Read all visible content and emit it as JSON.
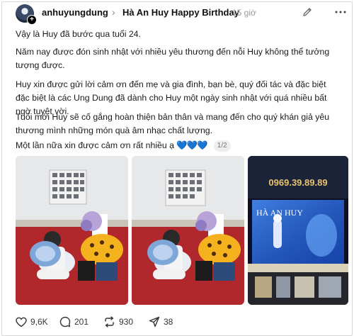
{
  "post": {
    "username": "anhuyungdung",
    "topic": "Hà An Huy Happy Birthday",
    "time_ago": "15 giờ",
    "paragraphs": [
      "Vậy là Huy đã bước qua tuổi 24.",
      "Năm nay được đón sinh nhật với nhiều yêu thương đến nỗi Huy không thể tưởng tượng được.",
      "Huy xin được gửi lời cảm ơn đến mẹ và gia đình, bạn bè, quý đối tác và đặc biệt đặc biệt là các Ung Dung đã dành cho Huy một ngày sinh nhật với quá nhiều bất ngờ tuyệt vời.",
      "Tuổi mới Huy sẽ cố gắng hoàn thiện bản thân và mang đến cho quý khán giả yêu thương mình những món quà âm nhạc chất lượng."
    ],
    "last_line": "Một lần nữa xin được cảm ơn rất nhiều ạ",
    "hearts": "💙💙💙",
    "pager": "1/2"
  },
  "billboard": {
    "phone": "0969.39.89.89",
    "name": "HÀ AN HUY"
  },
  "actions": {
    "likes": "9,6K",
    "comments": "201",
    "reposts": "930",
    "shares": "38"
  },
  "colors": {
    "heart_blue": "#2f7de1",
    "muted": "#9a9a9a",
    "billboard_blue": "#1c4fbf"
  }
}
